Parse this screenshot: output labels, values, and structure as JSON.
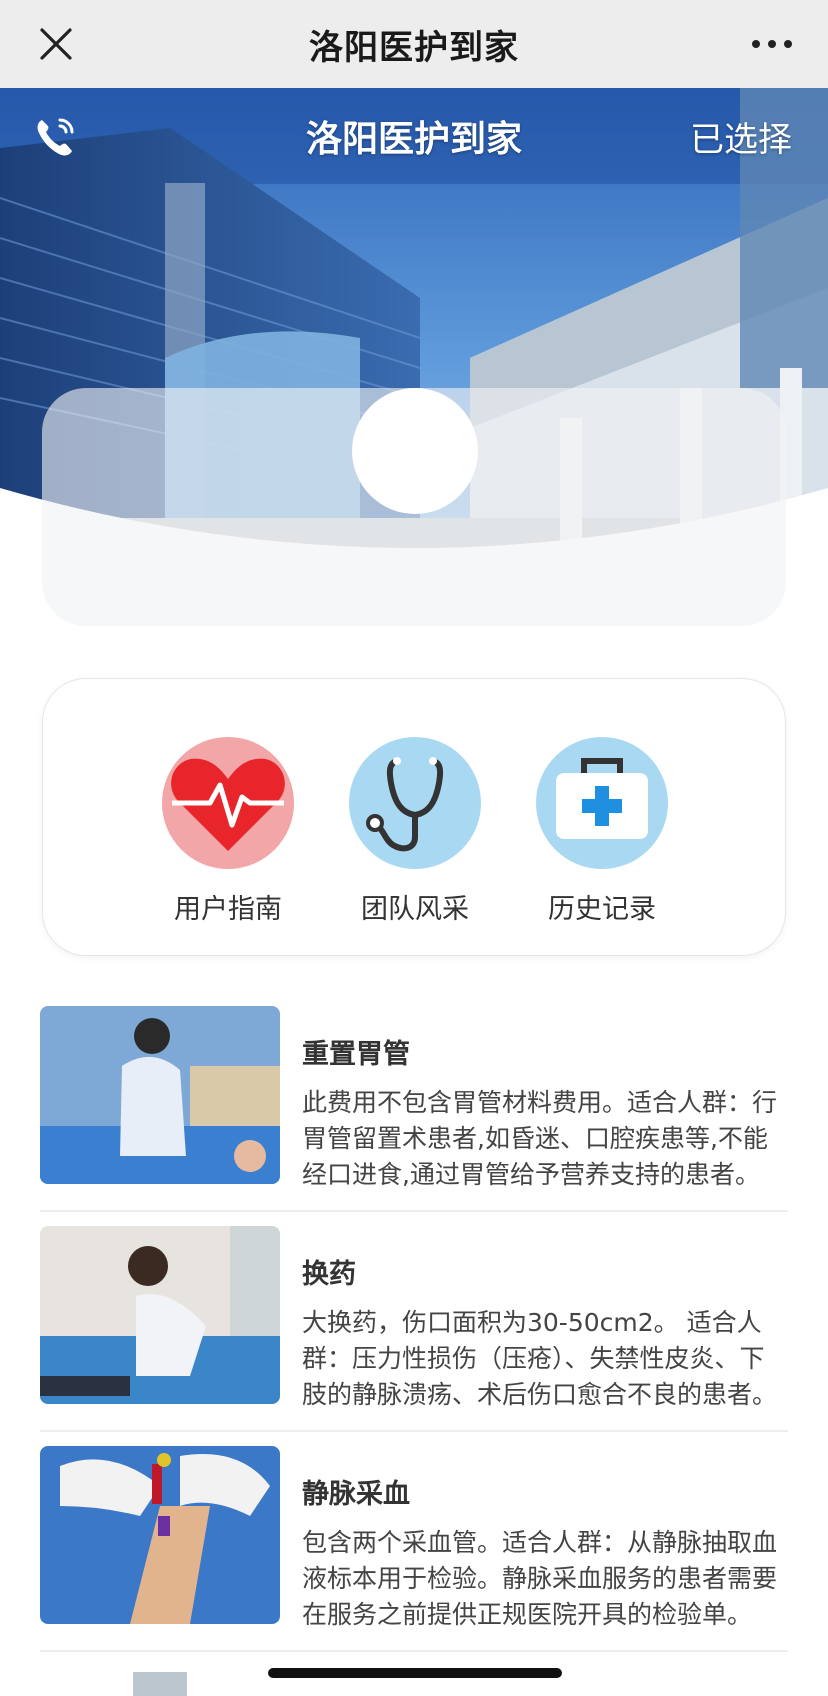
{
  "app": {
    "title": "洛阳医护到家"
  },
  "topbar": {
    "close_icon": "close-icon",
    "more_icon": "more-dots-icon"
  },
  "hero": {
    "title": "洛阳医护到家",
    "selected_label": "已选择",
    "phone_icon": "phone-icon"
  },
  "quick_actions": [
    {
      "label": "用户指南",
      "icon": "heartbeat-icon"
    },
    {
      "label": "团队风采",
      "icon": "stethoscope-icon"
    },
    {
      "label": "历史记录",
      "icon": "medical-kit-icon"
    }
  ],
  "services": [
    {
      "name": "重置胃管",
      "desc": "此费用不包含胃管材料费用。适合人群：行胃管留置术患者,如昏迷、口腔疾患等,不能经口进食,通过胃管给予营养支持的患者。"
    },
    {
      "name": "换药",
      "desc": "大换药，伤口面积为30-50cm2。 适合人群：压力性损伤（压疮）、失禁性皮炎、下肢的静脉溃疡、术后伤口愈合不良的患者。"
    },
    {
      "name": "静脉采血",
      "desc": "包含两个采血管。适合人群：从静脉抽取血液标本用于检验。静脉采血服务的患者需要在服务之前提供正规医院开具的检验单。"
    },
    {
      "name": "",
      "desc": ""
    }
  ],
  "colors": {
    "heart_bg": "#f2a6a8",
    "heart": "#e8252b",
    "blue_bg": "#a9d8f3",
    "topbar_bg": "#ededed"
  }
}
